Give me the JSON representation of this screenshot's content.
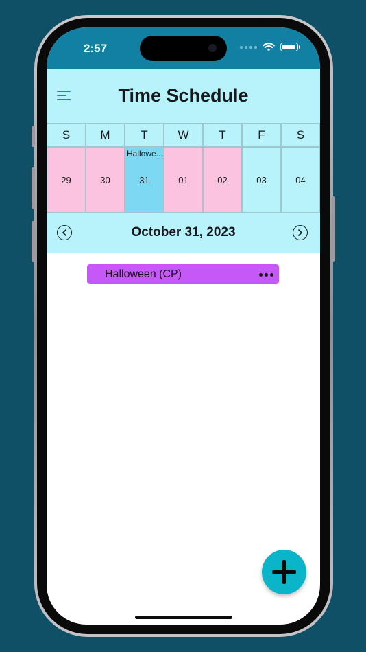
{
  "status_bar": {
    "time": "2:57"
  },
  "header": {
    "title": "Time Schedule"
  },
  "weekdays": [
    "S",
    "M",
    "T",
    "W",
    "T",
    "F",
    "S"
  ],
  "days": [
    {
      "num": "29",
      "event": "",
      "state": "pink"
    },
    {
      "num": "30",
      "event": "",
      "state": "pink"
    },
    {
      "num": "31",
      "event": "Hallowe...",
      "state": "selected"
    },
    {
      "num": "01",
      "event": "",
      "state": "pink"
    },
    {
      "num": "02",
      "event": "",
      "state": "pink"
    },
    {
      "num": "03",
      "event": "",
      "state": "plain"
    },
    {
      "num": "04",
      "event": "",
      "state": "plain"
    }
  ],
  "date_bar": {
    "label": "October 31, 2023",
    "prev_icon": "chevron-left-circle",
    "next_icon": "chevron-right-circle"
  },
  "events": [
    {
      "title": "Halloween (CP)",
      "color": "#c558f6"
    }
  ],
  "fab": {
    "icon": "plus-icon",
    "color": "#0ab4c9"
  },
  "colors": {
    "header_bg": "#b8f2fa",
    "status_bg": "#1280a2",
    "pink": "#fbc3e0",
    "selected": "#7dd8f3",
    "menu_icon": "#1e7ce8"
  }
}
